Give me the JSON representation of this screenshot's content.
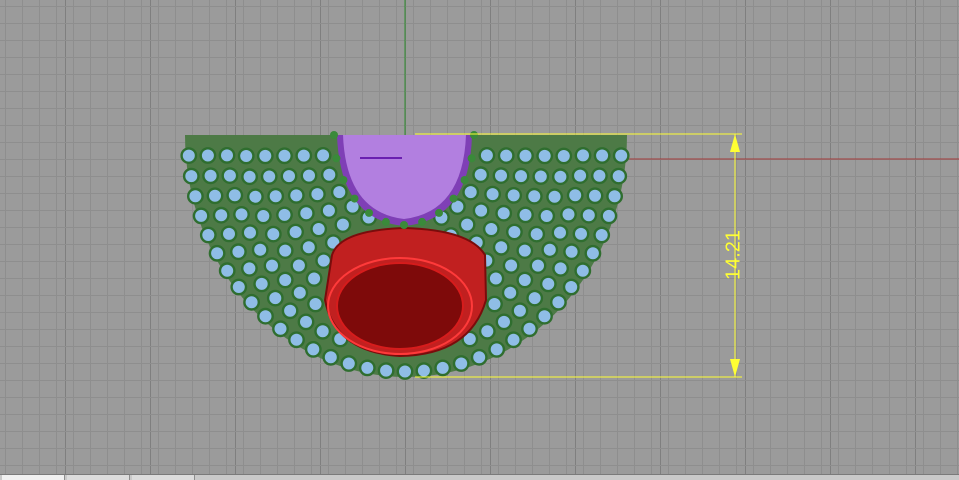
{
  "viewport": {
    "dimension_value": "14.21",
    "colors": {
      "background": "#9b9b9b",
      "grid_minor": "#8e8e8e",
      "grid_major": "#7f7f7f",
      "axis_x": "#a33a3a",
      "axis_y": "#2f8f2f",
      "dimension": "#ffff33",
      "gem": "#a25fd6",
      "stones": "#8fbde6",
      "prongs": "#2f7a2f",
      "opening": "#b10d0d"
    }
  },
  "viewport_tabs": [
    "",
    "",
    ""
  ]
}
